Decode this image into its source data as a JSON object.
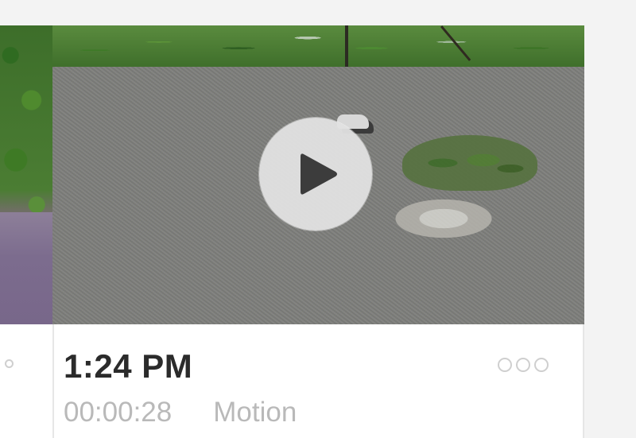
{
  "event": {
    "time": "1:24 PM",
    "duration": "00:00:28",
    "type": "Motion"
  },
  "icons": {
    "play": "play-icon",
    "more": "more-options-icon"
  },
  "colors": {
    "time_text": "#2b2b2b",
    "meta_text": "#b9b9b9",
    "card_background": "#ffffff",
    "page_background": "#f3f3f3",
    "play_button": "#e1e1e1",
    "play_glyph": "#3c3c3c",
    "dot_outline": "#cfcfcf"
  }
}
